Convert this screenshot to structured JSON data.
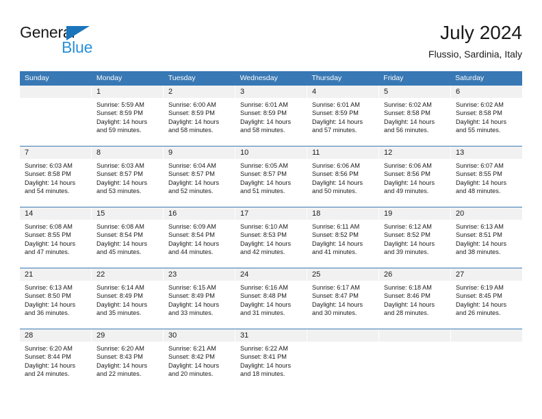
{
  "brand": {
    "name_top": "General",
    "name_bottom": "Blue",
    "accent_dark": "#1b75bb",
    "accent_light": "#2a90d6"
  },
  "header": {
    "title": "July 2024",
    "subtitle": "Flussio, Sardinia, Italy"
  },
  "theme": {
    "header_bar": "#3878b4",
    "daynum_band": "#f1f1f1",
    "text": "#1a1a1a"
  },
  "weekdays": [
    "Sunday",
    "Monday",
    "Tuesday",
    "Wednesday",
    "Thursday",
    "Friday",
    "Saturday"
  ],
  "weeks": [
    [
      {
        "day": "",
        "sunrise": "",
        "sunset": "",
        "daylight_line1": "",
        "daylight_line2": ""
      },
      {
        "day": "1",
        "sunrise": "Sunrise: 5:59 AM",
        "sunset": "Sunset: 8:59 PM",
        "daylight_line1": "Daylight: 14 hours",
        "daylight_line2": "and 59 minutes."
      },
      {
        "day": "2",
        "sunrise": "Sunrise: 6:00 AM",
        "sunset": "Sunset: 8:59 PM",
        "daylight_line1": "Daylight: 14 hours",
        "daylight_line2": "and 58 minutes."
      },
      {
        "day": "3",
        "sunrise": "Sunrise: 6:01 AM",
        "sunset": "Sunset: 8:59 PM",
        "daylight_line1": "Daylight: 14 hours",
        "daylight_line2": "and 58 minutes."
      },
      {
        "day": "4",
        "sunrise": "Sunrise: 6:01 AM",
        "sunset": "Sunset: 8:59 PM",
        "daylight_line1": "Daylight: 14 hours",
        "daylight_line2": "and 57 minutes."
      },
      {
        "day": "5",
        "sunrise": "Sunrise: 6:02 AM",
        "sunset": "Sunset: 8:58 PM",
        "daylight_line1": "Daylight: 14 hours",
        "daylight_line2": "and 56 minutes."
      },
      {
        "day": "6",
        "sunrise": "Sunrise: 6:02 AM",
        "sunset": "Sunset: 8:58 PM",
        "daylight_line1": "Daylight: 14 hours",
        "daylight_line2": "and 55 minutes."
      }
    ],
    [
      {
        "day": "7",
        "sunrise": "Sunrise: 6:03 AM",
        "sunset": "Sunset: 8:58 PM",
        "daylight_line1": "Daylight: 14 hours",
        "daylight_line2": "and 54 minutes."
      },
      {
        "day": "8",
        "sunrise": "Sunrise: 6:03 AM",
        "sunset": "Sunset: 8:57 PM",
        "daylight_line1": "Daylight: 14 hours",
        "daylight_line2": "and 53 minutes."
      },
      {
        "day": "9",
        "sunrise": "Sunrise: 6:04 AM",
        "sunset": "Sunset: 8:57 PM",
        "daylight_line1": "Daylight: 14 hours",
        "daylight_line2": "and 52 minutes."
      },
      {
        "day": "10",
        "sunrise": "Sunrise: 6:05 AM",
        "sunset": "Sunset: 8:57 PM",
        "daylight_line1": "Daylight: 14 hours",
        "daylight_line2": "and 51 minutes."
      },
      {
        "day": "11",
        "sunrise": "Sunrise: 6:06 AM",
        "sunset": "Sunset: 8:56 PM",
        "daylight_line1": "Daylight: 14 hours",
        "daylight_line2": "and 50 minutes."
      },
      {
        "day": "12",
        "sunrise": "Sunrise: 6:06 AM",
        "sunset": "Sunset: 8:56 PM",
        "daylight_line1": "Daylight: 14 hours",
        "daylight_line2": "and 49 minutes."
      },
      {
        "day": "13",
        "sunrise": "Sunrise: 6:07 AM",
        "sunset": "Sunset: 8:55 PM",
        "daylight_line1": "Daylight: 14 hours",
        "daylight_line2": "and 48 minutes."
      }
    ],
    [
      {
        "day": "14",
        "sunrise": "Sunrise: 6:08 AM",
        "sunset": "Sunset: 8:55 PM",
        "daylight_line1": "Daylight: 14 hours",
        "daylight_line2": "and 47 minutes."
      },
      {
        "day": "15",
        "sunrise": "Sunrise: 6:08 AM",
        "sunset": "Sunset: 8:54 PM",
        "daylight_line1": "Daylight: 14 hours",
        "daylight_line2": "and 45 minutes."
      },
      {
        "day": "16",
        "sunrise": "Sunrise: 6:09 AM",
        "sunset": "Sunset: 8:54 PM",
        "daylight_line1": "Daylight: 14 hours",
        "daylight_line2": "and 44 minutes."
      },
      {
        "day": "17",
        "sunrise": "Sunrise: 6:10 AM",
        "sunset": "Sunset: 8:53 PM",
        "daylight_line1": "Daylight: 14 hours",
        "daylight_line2": "and 42 minutes."
      },
      {
        "day": "18",
        "sunrise": "Sunrise: 6:11 AM",
        "sunset": "Sunset: 8:52 PM",
        "daylight_line1": "Daylight: 14 hours",
        "daylight_line2": "and 41 minutes."
      },
      {
        "day": "19",
        "sunrise": "Sunrise: 6:12 AM",
        "sunset": "Sunset: 8:52 PM",
        "daylight_line1": "Daylight: 14 hours",
        "daylight_line2": "and 39 minutes."
      },
      {
        "day": "20",
        "sunrise": "Sunrise: 6:13 AM",
        "sunset": "Sunset: 8:51 PM",
        "daylight_line1": "Daylight: 14 hours",
        "daylight_line2": "and 38 minutes."
      }
    ],
    [
      {
        "day": "21",
        "sunrise": "Sunrise: 6:13 AM",
        "sunset": "Sunset: 8:50 PM",
        "daylight_line1": "Daylight: 14 hours",
        "daylight_line2": "and 36 minutes."
      },
      {
        "day": "22",
        "sunrise": "Sunrise: 6:14 AM",
        "sunset": "Sunset: 8:49 PM",
        "daylight_line1": "Daylight: 14 hours",
        "daylight_line2": "and 35 minutes."
      },
      {
        "day": "23",
        "sunrise": "Sunrise: 6:15 AM",
        "sunset": "Sunset: 8:49 PM",
        "daylight_line1": "Daylight: 14 hours",
        "daylight_line2": "and 33 minutes."
      },
      {
        "day": "24",
        "sunrise": "Sunrise: 6:16 AM",
        "sunset": "Sunset: 8:48 PM",
        "daylight_line1": "Daylight: 14 hours",
        "daylight_line2": "and 31 minutes."
      },
      {
        "day": "25",
        "sunrise": "Sunrise: 6:17 AM",
        "sunset": "Sunset: 8:47 PM",
        "daylight_line1": "Daylight: 14 hours",
        "daylight_line2": "and 30 minutes."
      },
      {
        "day": "26",
        "sunrise": "Sunrise: 6:18 AM",
        "sunset": "Sunset: 8:46 PM",
        "daylight_line1": "Daylight: 14 hours",
        "daylight_line2": "and 28 minutes."
      },
      {
        "day": "27",
        "sunrise": "Sunrise: 6:19 AM",
        "sunset": "Sunset: 8:45 PM",
        "daylight_line1": "Daylight: 14 hours",
        "daylight_line2": "and 26 minutes."
      }
    ],
    [
      {
        "day": "28",
        "sunrise": "Sunrise: 6:20 AM",
        "sunset": "Sunset: 8:44 PM",
        "daylight_line1": "Daylight: 14 hours",
        "daylight_line2": "and 24 minutes."
      },
      {
        "day": "29",
        "sunrise": "Sunrise: 6:20 AM",
        "sunset": "Sunset: 8:43 PM",
        "daylight_line1": "Daylight: 14 hours",
        "daylight_line2": "and 22 minutes."
      },
      {
        "day": "30",
        "sunrise": "Sunrise: 6:21 AM",
        "sunset": "Sunset: 8:42 PM",
        "daylight_line1": "Daylight: 14 hours",
        "daylight_line2": "and 20 minutes."
      },
      {
        "day": "31",
        "sunrise": "Sunrise: 6:22 AM",
        "sunset": "Sunset: 8:41 PM",
        "daylight_line1": "Daylight: 14 hours",
        "daylight_line2": "and 18 minutes."
      },
      {
        "day": "",
        "sunrise": "",
        "sunset": "",
        "daylight_line1": "",
        "daylight_line2": ""
      },
      {
        "day": "",
        "sunrise": "",
        "sunset": "",
        "daylight_line1": "",
        "daylight_line2": ""
      },
      {
        "day": "",
        "sunrise": "",
        "sunset": "",
        "daylight_line1": "",
        "daylight_line2": ""
      }
    ]
  ]
}
